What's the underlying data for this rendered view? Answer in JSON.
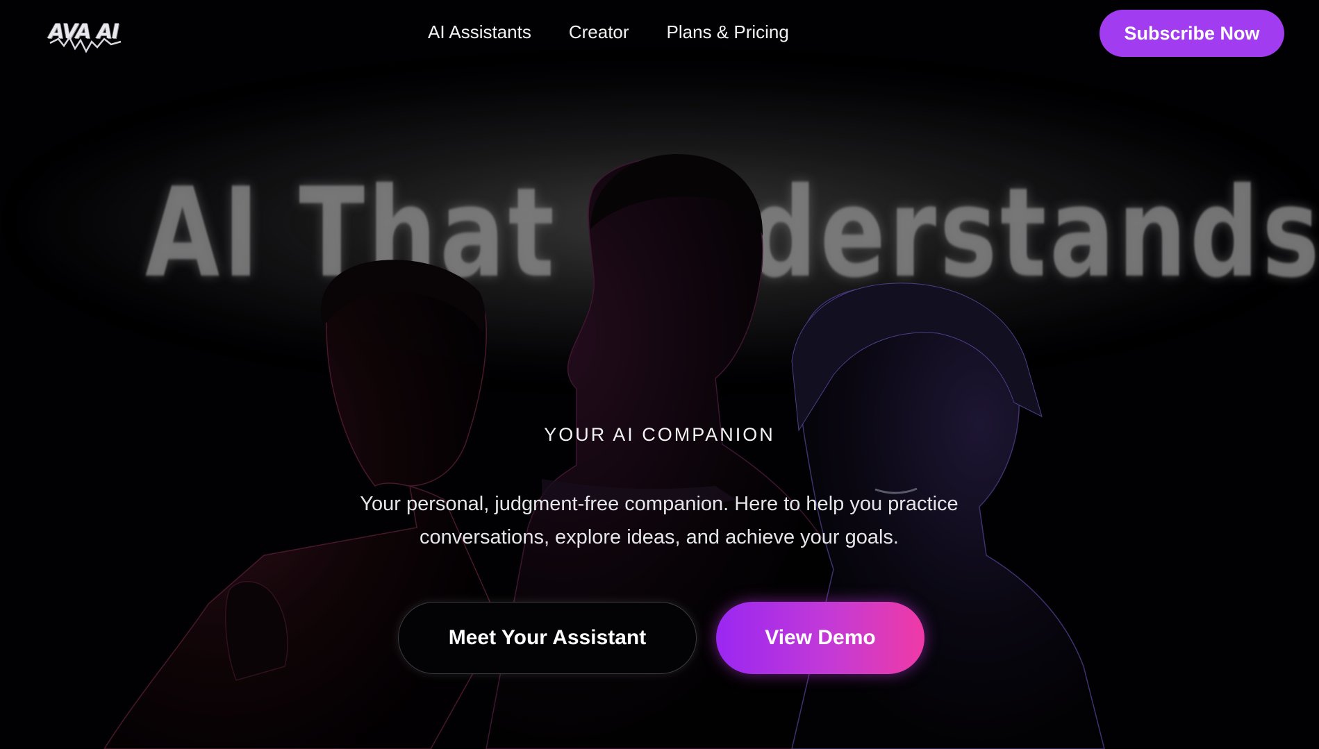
{
  "brand": {
    "logo_text": "AVA AI"
  },
  "nav": {
    "links": [
      "AI Assistants",
      "Creator",
      "Plans & Pricing"
    ],
    "cta_label": "Subscribe Now"
  },
  "hero": {
    "headline": "AI That Understands You",
    "eyebrow": "YOUR AI COMPANION",
    "subtitle_line1": "Your personal, judgment-free companion. Here to help you practice",
    "subtitle_line2": "conversations, explore ideas, and achieve your goals.",
    "primary_button": "Meet Your Assistant",
    "secondary_button": "View Demo"
  },
  "colors": {
    "background": "#020103",
    "accent_purple": "#a13cf0",
    "gradient_start": "#9a27f2",
    "gradient_end": "#ef3aa6"
  }
}
